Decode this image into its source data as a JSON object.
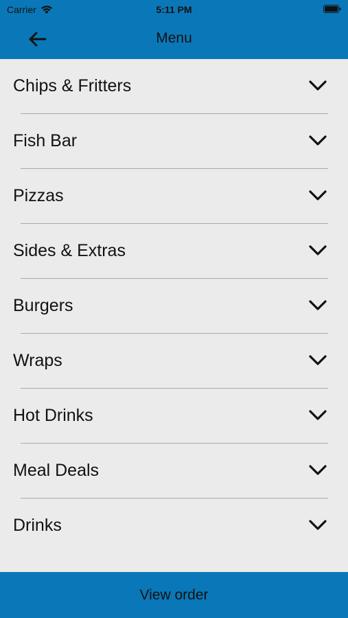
{
  "status_bar": {
    "carrier": "Carrier",
    "time": "5:11 PM",
    "wifi_icon": "wifi-icon",
    "battery_icon": "battery-icon"
  },
  "navbar": {
    "title": "Menu",
    "back_icon": "arrow-left-icon"
  },
  "menu": {
    "items": [
      {
        "label": "Chips & Fritters"
      },
      {
        "label": "Fish Bar"
      },
      {
        "label": "Pizzas"
      },
      {
        "label": "Sides & Extras"
      },
      {
        "label": "Burgers"
      },
      {
        "label": "Wraps"
      },
      {
        "label": "Hot Drinks"
      },
      {
        "label": "Meal Deals"
      },
      {
        "label": "Drinks"
      }
    ],
    "expand_icon": "chevron-down-icon"
  },
  "footer": {
    "button_label": "View order"
  },
  "colors": {
    "accent": "#0a78b8",
    "background": "#ebebeb",
    "divider": "#a9a9a9",
    "text": "#111111"
  }
}
